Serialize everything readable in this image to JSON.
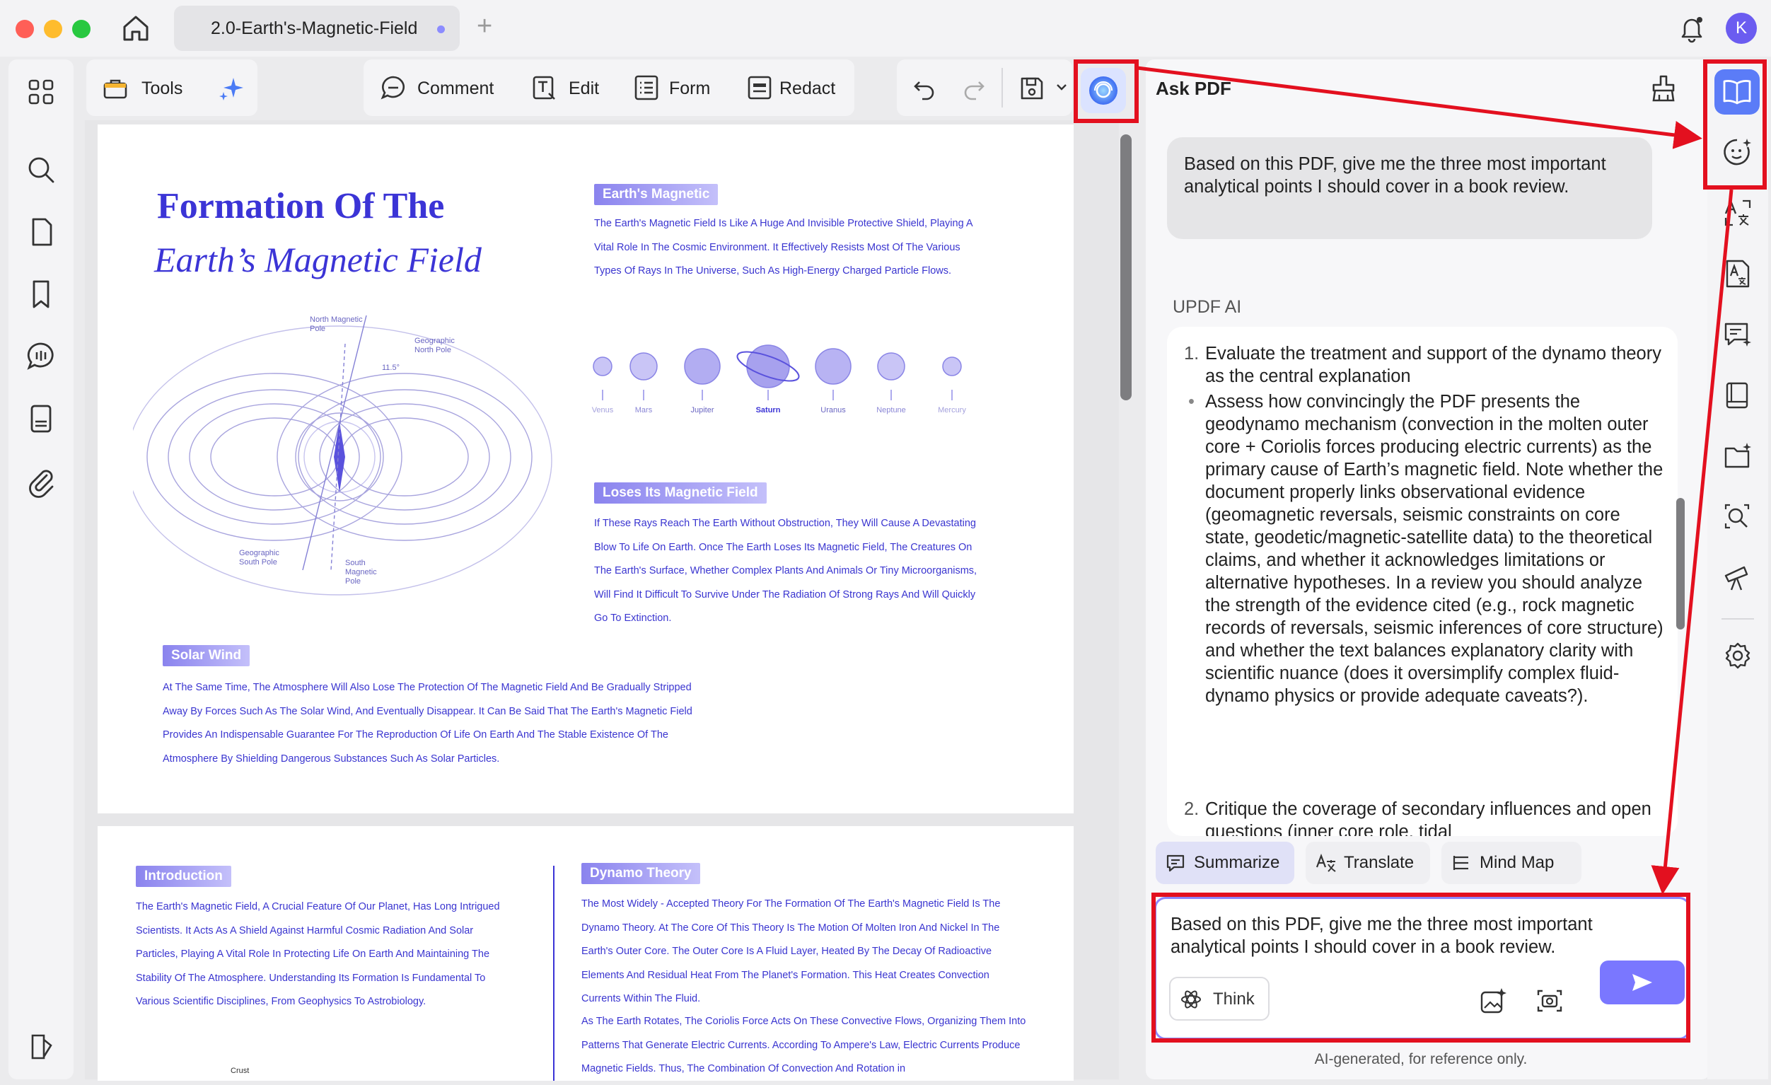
{
  "window": {
    "tab_title": "2.0-Earth's-Magnetic-Field",
    "avatar_initial": "K"
  },
  "toolbar": {
    "tools_label": "Tools",
    "comment_label": "Comment",
    "edit_label": "Edit",
    "form_label": "Form",
    "redact_label": "Redact"
  },
  "document": {
    "title_line1": "Formation Of The",
    "title_line2": "Earth’s Magnetic Field",
    "diagram_labels": {
      "north_magnetic": "North Magnetic Pole",
      "geo_north": "Geographic North Pole",
      "geo_south": "Geographic South Pole",
      "south_magnetic": "South Magnetic Pole",
      "angle": "11.5°"
    },
    "earths_magnetic": {
      "heading": "Earth's Magnetic",
      "body": "The Earth's Magnetic Field Is Like A Huge And Invisible Protective Shield, Playing A Vital Role In The Cosmic Environment. It Effectively Resists Most Of The Various Types Of Rays In The Universe, Such As High-Energy Charged Particle Flows."
    },
    "planets": [
      "Venus",
      "Mars",
      "Jupiter",
      "Saturn",
      "Uranus",
      "Neptune",
      "Mercury"
    ],
    "loses_field": {
      "heading": "Loses Its Magnetic Field",
      "body": "If These Rays Reach The Earth Without Obstruction, They Will Cause A Devastating Blow To Life On Earth. Once The Earth Loses Its Magnetic Field, The Creatures On The Earth's Surface, Whether Complex Plants And Animals Or Tiny Microorganisms, Will Find It Difficult To Survive Under The Radiation Of Strong Rays And Will Quickly Go To Extinction."
    },
    "solar_wind": {
      "heading": "Solar Wind",
      "body": "At The Same Time, The Atmosphere Will Also Lose The Protection Of The Magnetic Field And Be Gradually Stripped Away By Forces Such As The Solar Wind, And Eventually Disappear. It Can Be Said That The Earth's Magnetic Field Provides An Indispensable Guarantee For The Reproduction Of Life On Earth And The Stable Existence Of The Atmosphere By Shielding Dangerous Substances Such As Solar Particles."
    },
    "introduction": {
      "heading": "Introduction",
      "body": "The Earth's Magnetic Field, A Crucial Feature Of Our Planet, Has Long Intrigued Scientists. It Acts As A Shield Against Harmful Cosmic Radiation And Solar Particles, Playing A Vital Role In Protecting Life On Earth And Maintaining The Stability Of The Atmosphere. Understanding Its Formation Is Fundamental To Various Scientific Disciplines, From Geophysics To Astrobiology.",
      "crust_label": "Crust"
    },
    "dynamo": {
      "heading": "Dynamo Theory",
      "body": "The Most Widely - Accepted Theory For The Formation Of The Earth's Magnetic Field Is The Dynamo Theory. At The Core Of This Theory Is The Motion Of Molten Iron And Nickel In The Earth's Outer Core. The Outer Core Is A Fluid Layer, Heated By The Decay Of Radioactive Elements And Residual Heat From The Planet's Formation. This Heat Creates Convection Currents Within The Fluid.",
      "body2": "As The Earth Rotates, The Coriolis Force Acts On These Convective Flows, Organizing Them Into Patterns That Generate Electric Currents. According To Ampere's Law, Electric Currents Produce Magnetic Fields. Thus, The Combination Of Convection And Rotation in"
    }
  },
  "panel": {
    "title": "Ask PDF",
    "user_question": "Based on this PDF, give me the three most important analytical points I should cover in a book review.",
    "ai_label": "UPDF AI",
    "answer": {
      "item1_num": "1.",
      "item1": "Evaluate the treatment and support of the dynamo theory as the central explanation",
      "bullet": "•",
      "bullet1": "Assess how convincingly the PDF presents the geodynamo mechanism (convection in the molten outer core + Coriolis forces producing electric currents) as the primary cause of Earth’s magnetic field. Note whether the document properly links observational evidence (geomagnetic reversals, seismic constraints on core state, geodetic/magnetic-satellite data) to the theoretical claims, and whether it acknowledges limitations or alternative hypotheses. In a review you should analyze the strength of the evidence cited (e.g., rock magnetic records of reversals, seismic inferences of core structure) and whether the text balances explanatory clarity with scientific nuance (does it oversimplify complex fluid-dynamo physics or provide adequate caveats?).",
      "item2_num": "2.",
      "item2": "Critique the coverage of secondary influences and open questions (inner core role, tidal"
    },
    "chips": {
      "summarize": "Summarize",
      "translate": "Translate",
      "mindmap": "Mind Map"
    },
    "input_text": "Based on this PDF, give me the three most important analytical points I should cover in a book review.",
    "think_label": "Think",
    "footer": "AI-generated, for reference only."
  },
  "colors": {
    "accent": "#7a77ff",
    "doc_blue": "#3a35d0",
    "highlight_red": "#e3101f"
  }
}
